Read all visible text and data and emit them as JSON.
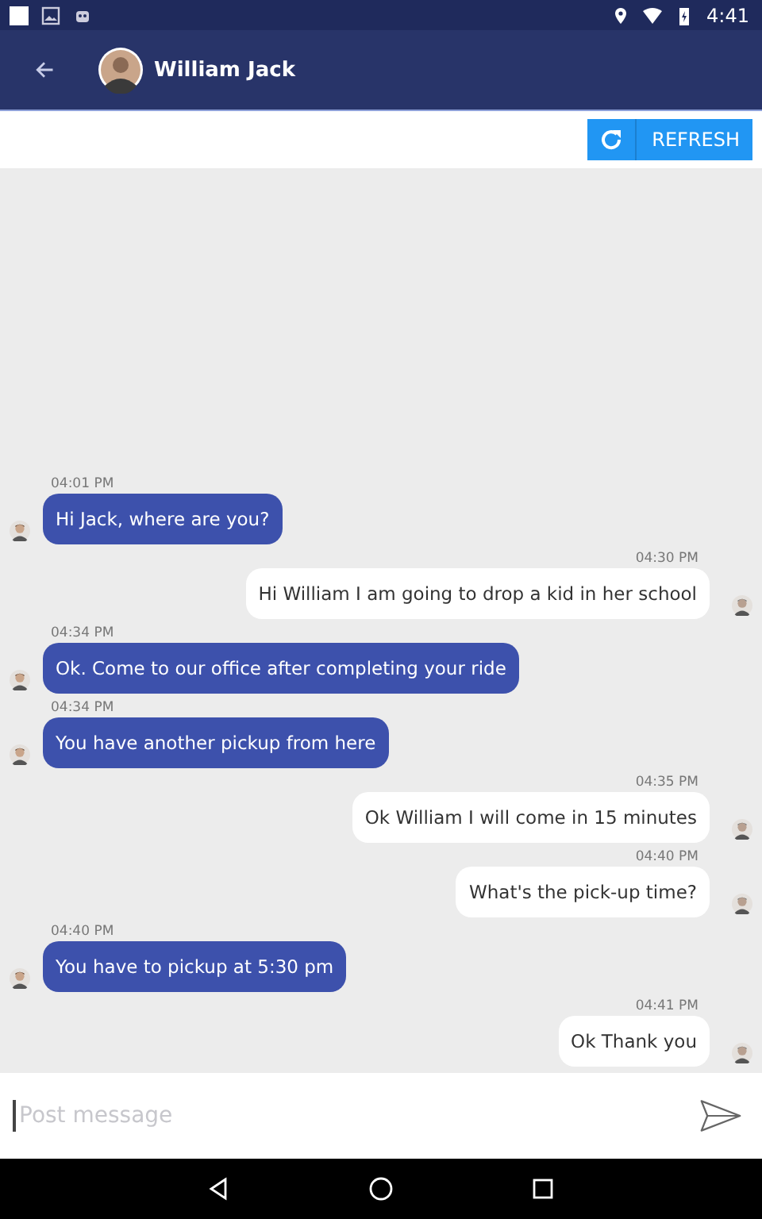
{
  "status_bar": {
    "time": "4:41"
  },
  "header": {
    "title": "William Jack"
  },
  "toolbar": {
    "refresh_label": "REFRESH"
  },
  "messages": [
    {
      "kind": "incoming",
      "time": "04:01 PM",
      "text": "Hi Jack, where are you?"
    },
    {
      "kind": "outgoing",
      "time": "04:30 PM",
      "text": "Hi William I am going to drop a kid in her school"
    },
    {
      "kind": "incoming",
      "time": "04:34 PM",
      "text": "Ok. Come to our office after completing your ride"
    },
    {
      "kind": "incoming",
      "time": "04:34 PM",
      "text": "You have another pickup from here"
    },
    {
      "kind": "outgoing",
      "time": "04:35 PM",
      "text": "Ok William I will come in 15 minutes"
    },
    {
      "kind": "outgoing",
      "time": "04:40 PM",
      "text": "What's the pick-up time?"
    },
    {
      "kind": "incoming",
      "time": "04:40 PM",
      "text": "You have to pickup at 5:30 pm"
    },
    {
      "kind": "outgoing",
      "time": "04:41 PM",
      "text": "Ok Thank you"
    }
  ],
  "composer": {
    "placeholder": "Post message"
  }
}
